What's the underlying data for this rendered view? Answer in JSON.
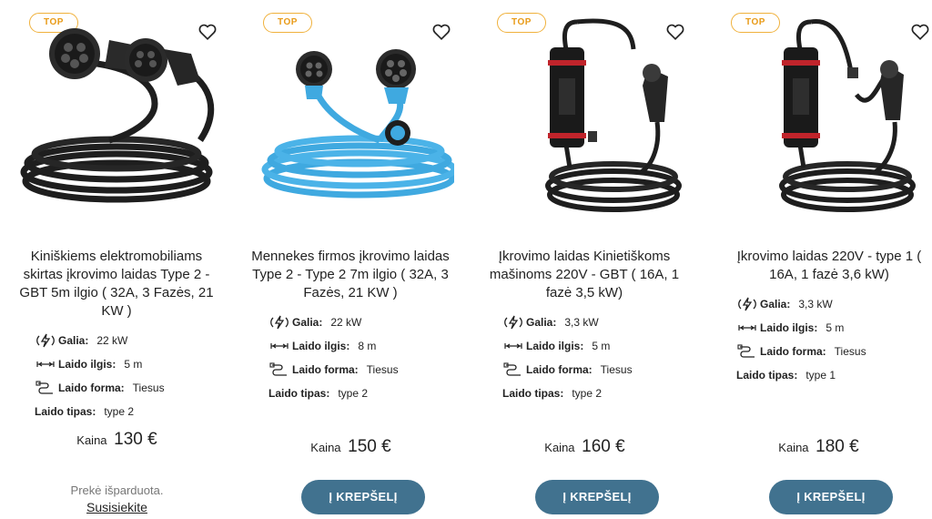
{
  "products": [
    {
      "badge": "TOP",
      "title": "Kiniškiems elektromobiliams skirtas įkrovimo laidas Type 2 - GBT 5m ilgio ( 32A, 3 Fazės, 21 KW )",
      "specs": [
        {
          "label": "Galia:",
          "value": "22 kW",
          "icon": "power-icon"
        },
        {
          "label": "Laido ilgis:",
          "value": "5 m",
          "icon": "length-icon"
        },
        {
          "label": "Laido forma:",
          "value": "Tiesus",
          "icon": "cable-shape-icon"
        },
        {
          "label": "Laido tipas:",
          "value": "type 2",
          "icon": ""
        }
      ],
      "price_label": "Kaina",
      "price": "130 €",
      "sold_out_text": "Prekė išparduota.",
      "contact_link": "Susisiekite",
      "cable_color": "#1e1e1e"
    },
    {
      "badge": "TOP",
      "title": "Mennekes firmos įkrovimo laidas Type 2 - Type 2 7m ilgio ( 32A, 3 Fazės, 21 KW )",
      "specs": [
        {
          "label": "Galia:",
          "value": "22 kW",
          "icon": "power-icon"
        },
        {
          "label": "Laido ilgis:",
          "value": "8 m",
          "icon": "length-icon"
        },
        {
          "label": "Laido forma:",
          "value": "Tiesus",
          "icon": "cable-shape-icon"
        },
        {
          "label": "Laido tipas:",
          "value": "type 2",
          "icon": ""
        }
      ],
      "price_label": "Kaina",
      "price": "150 €",
      "button": "Į KREPŠELĮ",
      "cable_color": "#3fa9e0"
    },
    {
      "badge": "TOP",
      "title": "Įkrovimo laidas Kinietiškoms mašinoms 220V - GBT ( 16A, 1 fazė 3,5 kW)",
      "specs": [
        {
          "label": "Galia:",
          "value": "3,3 kW",
          "icon": "power-icon"
        },
        {
          "label": "Laido ilgis:",
          "value": "5 m",
          "icon": "length-icon"
        },
        {
          "label": "Laido forma:",
          "value": "Tiesus",
          "icon": "cable-shape-icon"
        },
        {
          "label": "Laido tipas:",
          "value": "type 2",
          "icon": ""
        }
      ],
      "price_label": "Kaina",
      "price": "160 €",
      "button": "Į KREPŠELĮ",
      "cable_color": "#1e1e1e"
    },
    {
      "badge": "TOP",
      "title": "Įkrovimo laidas 220V - type 1 ( 16A, 1 fazė 3,6 kW)",
      "specs": [
        {
          "label": "Galia:",
          "value": "3,3 kW",
          "icon": "power-icon"
        },
        {
          "label": "Laido ilgis:",
          "value": "5 m",
          "icon": "length-icon"
        },
        {
          "label": "Laido forma:",
          "value": "Tiesus",
          "icon": "cable-shape-icon"
        },
        {
          "label": "Laido tipas:",
          "value": "type 1",
          "icon": ""
        }
      ],
      "price_label": "Kaina",
      "price": "180 €",
      "button": "Į KREPŠELĮ",
      "cable_color": "#1e1e1e"
    }
  ],
  "colors": {
    "badge": "#f0b13c",
    "button": "#41728f"
  }
}
